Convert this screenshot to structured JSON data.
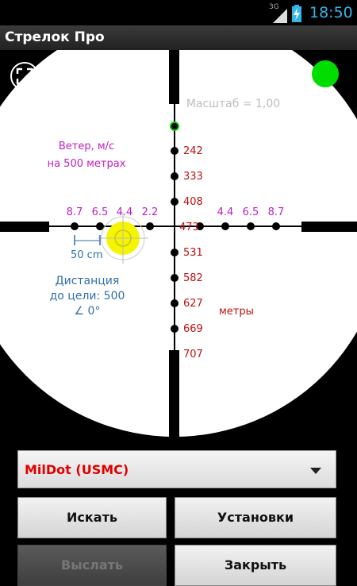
{
  "status_bar": {
    "network": "3G",
    "time": "18:50"
  },
  "app": {
    "title": "Стрелок Про"
  },
  "scope": {
    "zoom_label": "Масштаб = 1,00",
    "wind_label_line1": "Ветер, м/с",
    "wind_label_line2": "на 500 метрах",
    "wind_left": [
      "8.7",
      "6.5",
      "4.4",
      "2.2"
    ],
    "wind_right": [
      "4.4",
      "6.5",
      "8.7"
    ],
    "range_marks": [
      "242",
      "333",
      "408",
      "473",
      "531",
      "582",
      "627",
      "669",
      "707"
    ],
    "range_unit": "метры",
    "scale_text": "50 cm",
    "distance_line1": "Дистанция",
    "distance_line2": "до цели: 500",
    "angle": "∠ 0°",
    "colors": {
      "wind": "#c020c0",
      "range": "#c01010",
      "info": "#2f6fa8",
      "zoom": "#bdbdbd",
      "indicator": "#00dd00",
      "target": "#f5f500"
    }
  },
  "controls": {
    "reticle_select": "MilDot (USMC)",
    "search_button": "Искать",
    "settings_button": "Установки",
    "send_button": "Выслать",
    "close_button": "Закрыть"
  }
}
